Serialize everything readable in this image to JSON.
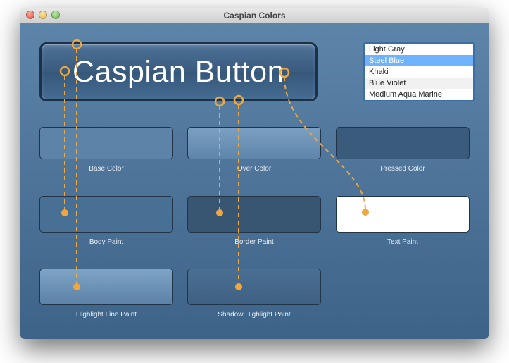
{
  "window": {
    "title": "Caspian Colors"
  },
  "button": {
    "label": "Caspian Button"
  },
  "color_list": {
    "items": [
      "Light Gray",
      "Steel Blue",
      "Khaki",
      "Blue Violet",
      "Medium Aqua Marine"
    ],
    "selected_index": 1
  },
  "swatches": {
    "base": {
      "label": "Base Color",
      "color": "#5d84a8"
    },
    "over": {
      "label": "Over Color",
      "color": "#7ba0c3"
    },
    "pressed": {
      "label": "Pressed Color",
      "color": "#3a5b7b"
    },
    "body": {
      "label": "Body Paint",
      "color": "#486f94"
    },
    "border": {
      "label": "Border Paint",
      "color": "#385572"
    },
    "text": {
      "label": "Text Paint",
      "color": "#ffffff"
    },
    "hiline": {
      "label": "Highlight Line Paint",
      "color": "#7ea3c5"
    },
    "shhl": {
      "label": "Shadow Highlight Paint",
      "color": "#496f92"
    }
  },
  "accent": "#f2a73a"
}
